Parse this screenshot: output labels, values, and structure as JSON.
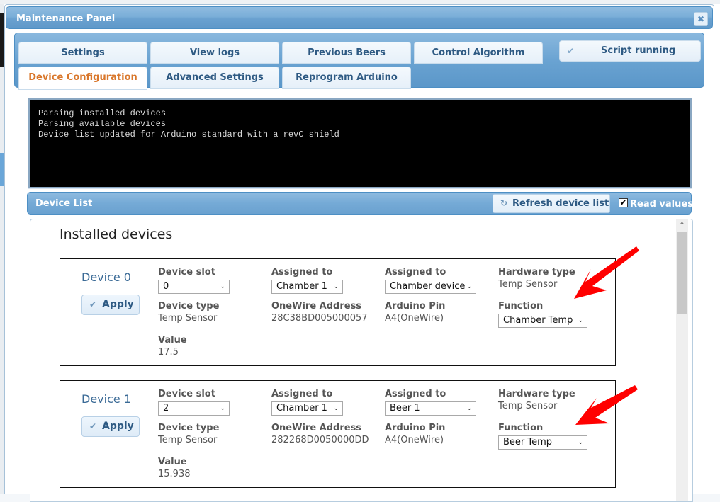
{
  "dialog": {
    "title": "Maintenance Panel",
    "close_icon": "close-icon",
    "close_glyph": "✖"
  },
  "tabs": [
    {
      "label": "Settings",
      "active": false
    },
    {
      "label": "View logs",
      "active": false
    },
    {
      "label": "Previous Beers",
      "active": false
    },
    {
      "label": "Control Algorithm",
      "active": false
    },
    {
      "label": "Device Configuration",
      "active": true
    },
    {
      "label": "Advanced Settings",
      "active": false
    },
    {
      "label": "Reprogram Arduino",
      "active": false
    }
  ],
  "script_status": {
    "icon": "check-icon",
    "glyph": "✔",
    "label": "Script running"
  },
  "console": {
    "lines": [
      "Parsing installed devices",
      "Parsing available devices",
      "Device list updated for Arduino standard with a revC shield"
    ]
  },
  "device_list": {
    "title": "Device List",
    "refresh_button": {
      "icon": "refresh-icon",
      "glyph": "↻",
      "label": "Refresh device list"
    },
    "read_values": {
      "label": "Read values",
      "checked": true,
      "glyph": "✔"
    },
    "heading": "Installed devices",
    "scroll_up_glyph": "⌃",
    "labels": {
      "device_slot": "Device slot",
      "assigned_to": "Assigned to",
      "hardware_type": "Hardware type",
      "device_type": "Device type",
      "onewire_address": "OneWire Address",
      "arduino_pin": "Arduino Pin",
      "function": "Function",
      "value": "Value",
      "apply": "Apply",
      "apply_glyph": "✔",
      "select_arrow": "⌄"
    },
    "devices": [
      {
        "name": "Device 0",
        "device_slot": "0",
        "assigned_chamber": "Chamber 1",
        "assigned_beer": "Chamber device",
        "hardware_type": "Temp Sensor",
        "device_type": "Temp Sensor",
        "onewire_address": "28C38BD005000057",
        "arduino_pin": "A4(OneWire)",
        "function": "Chamber Temp",
        "value": "17.5"
      },
      {
        "name": "Device 1",
        "device_slot": "2",
        "assigned_chamber": "Chamber 1",
        "assigned_beer": "Beer 1",
        "hardware_type": "Temp Sensor",
        "device_type": "Temp Sensor",
        "onewire_address": "282268D0050000DD",
        "arduino_pin": "A4(OneWire)",
        "function": "Beer Temp",
        "value": "15.938"
      }
    ]
  },
  "annotations": {
    "arrow_color": "#ff0000"
  }
}
